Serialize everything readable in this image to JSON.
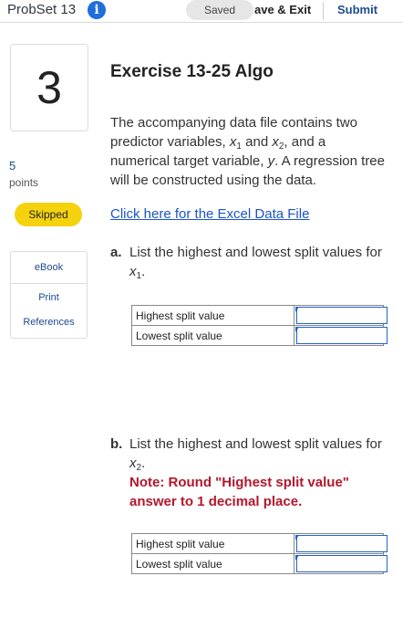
{
  "header": {
    "app_title": "ProbSet 13",
    "info_icon_glyph": "i",
    "saved_label": "Saved",
    "save_exit_label": "ave & Exit",
    "submit_label": "Submit"
  },
  "sidebar": {
    "question_number": "3",
    "points_value": "5",
    "points_label": "points",
    "status_badge": "Skipped",
    "links": [
      "eBook",
      "Print",
      "References"
    ]
  },
  "exercise": {
    "title": "Exercise 13-25 Algo",
    "intro_parts": [
      "The accompanying data file contains two predictor variables, ",
      "x",
      "1",
      " and ",
      "x",
      "2",
      ", and a numerical target variable, ",
      "y",
      ". A regression tree will be constructed using the data."
    ],
    "file_link": "Click here for the Excel Data File",
    "part_a": {
      "letter": "a.",
      "text": "List the highest and lowest split values for ",
      "var": "x",
      "sub": "1",
      "end": ".",
      "rows": [
        "Highest split value",
        "Lowest split value"
      ],
      "values": [
        "",
        ""
      ]
    },
    "part_b": {
      "letter": "b.",
      "text": "List the highest and lowest split values for ",
      "var": "x",
      "sub": "2",
      "end": ".",
      "note": "Note: Round \"Highest split value\" answer to 1 decimal place.",
      "rows": [
        "Highest split value",
        "Lowest split value"
      ],
      "values": [
        "",
        ""
      ]
    }
  },
  "colors": {
    "accent_blue": "#1e6fd9",
    "link_blue": "#1a55c5",
    "skipped_yellow": "#f5d20e",
    "note_red": "#b3172c"
  },
  "icons": {
    "info": "info-icon",
    "input_marker": "blue-triangle-marker"
  }
}
